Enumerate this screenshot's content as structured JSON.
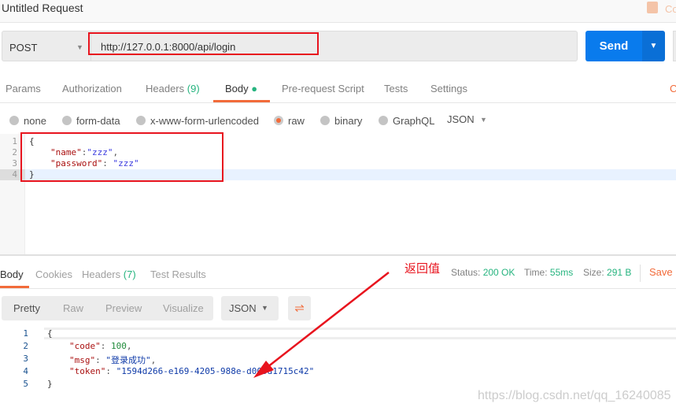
{
  "header": {
    "title": "Untitled Request",
    "comments_label": "Co"
  },
  "request": {
    "method": "POST",
    "url": "http://127.0.0.1:8000/api/login",
    "send_label": "Send"
  },
  "tabs": [
    {
      "label": "Params"
    },
    {
      "label": "Authorization"
    },
    {
      "label": "Headers",
      "count": "(9)"
    },
    {
      "label": "Body",
      "active": true
    },
    {
      "label": "Pre-request Script"
    },
    {
      "label": "Tests"
    },
    {
      "label": "Settings"
    }
  ],
  "tabs_right": "C",
  "body_types": [
    {
      "label": "none"
    },
    {
      "label": "form-data"
    },
    {
      "label": "x-www-form-urlencoded"
    },
    {
      "label": "raw",
      "selected": true
    },
    {
      "label": "binary"
    },
    {
      "label": "GraphQL"
    }
  ],
  "body_format": "JSON",
  "editor": {
    "line_numbers": [
      "1",
      "2",
      "3",
      "4"
    ],
    "lines": [
      {
        "text": "{"
      },
      {
        "key": "\"name\"",
        "sep": ":",
        "val": "\"zzz\"",
        "end": ","
      },
      {
        "key": "\"password\"",
        "sep": ": ",
        "val": "\"zzz\""
      },
      {
        "text": "}"
      }
    ]
  },
  "response": {
    "tabs": [
      {
        "label": "Body"
      },
      {
        "label": "Cookies"
      },
      {
        "label": "Headers",
        "count": "(7)"
      },
      {
        "label": "Test Results"
      }
    ],
    "status_label": "Status:",
    "status": "200 OK",
    "time_label": "Time:",
    "time": "55ms",
    "size_label": "Size:",
    "size": "291 B",
    "save_label": "Save R",
    "views": [
      "Pretty",
      "Raw",
      "Preview",
      "Visualize"
    ],
    "format": "JSON",
    "line_numbers": [
      "1",
      "2",
      "3",
      "4",
      "5"
    ],
    "code": [
      {
        "key": "\"code\"",
        "val": "100",
        "end": ","
      },
      {
        "key": "\"msg\"",
        "val": "\"登录成功\"",
        "end": ","
      },
      {
        "key": "\"token\"",
        "val": "\"1594d266-e169-4205-988e-d005d1715c42\""
      }
    ],
    "open": "{",
    "close": "}"
  },
  "annotation": "返回值",
  "watermark": "https://blog.csdn.net/qq_16240085",
  "colors": {
    "accent": "#f26b3a",
    "send": "#097bed",
    "success": "#26b47f",
    "annotation": "#e8141e"
  }
}
